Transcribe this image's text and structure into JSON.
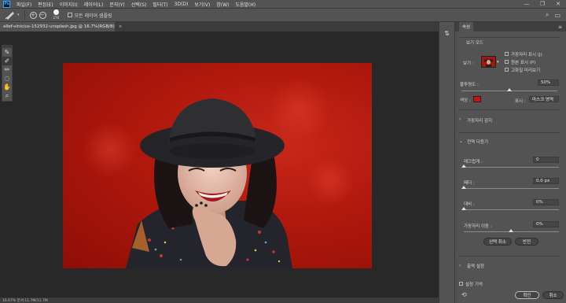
{
  "app": {
    "logo": "Ps"
  },
  "menu": [
    "파일(F)",
    "편집(E)",
    "이미지(I)",
    "레이어(L)",
    "문자(Y)",
    "선택(S)",
    "필터(T)",
    "3D(D)",
    "보기(V)",
    "창(W)",
    "도움말(H)"
  ],
  "window_controls": [
    "—",
    "❐",
    "✕"
  ],
  "options": {
    "brush_size": "276",
    "sample_all_layers": "모든 레이어 샘플링",
    "plus": "+",
    "minus": "−",
    "search_icon": "⌕",
    "layout_icon": "▭"
  },
  "document": {
    "tab_title": "allef-vinicius-152932-unsplash.jpg @ 16.7%(RGB/8)",
    "close": "×"
  },
  "status": {
    "text": "16.67%    문서:11.7M/11.7M"
  },
  "properties": {
    "tab": "속성",
    "menu": "≡",
    "view_mode_title": "보기 모드",
    "view_label": "보기 :",
    "show_edge": "가장자리 표시 (J)",
    "show_original": "원본 표시 (P)",
    "hq_preview": "고화질 미리보기",
    "transparency_label": "불투명도 :",
    "transparency_value": "50%",
    "color_label": "색상 :",
    "display_label": "표시 :",
    "display_value": "마스크 영역",
    "edge_detection": "가장자리 감지",
    "global_refinements": "전역 다듬기",
    "smooth_label": "매끄럽게 :",
    "smooth_value": "0",
    "feather_label": "페더 :",
    "feather_value": "0.0 px",
    "contrast_label": "대비 :",
    "contrast_value": "0%",
    "shift_edge_label": "가장자리 이동 :",
    "shift_edge_value": "0%",
    "clear_selection": "선택 취소",
    "invert": "반전",
    "output_settings": "출력 설정",
    "remember_settings": "설정 기억",
    "ok": "확인",
    "cancel": "취소"
  },
  "colors": {
    "mask_red": "#d0100a",
    "ui_gray": "#535353",
    "canvas_bg": "#282828"
  }
}
